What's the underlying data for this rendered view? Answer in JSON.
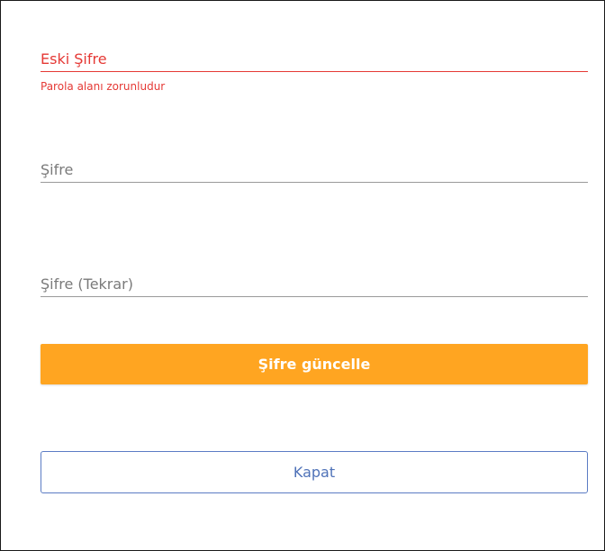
{
  "form": {
    "old_password": {
      "placeholder": "Eski Şifre",
      "value": "",
      "error": "Parola alanı zorunludur"
    },
    "new_password": {
      "placeholder": "Şifre",
      "value": ""
    },
    "repeat_password": {
      "placeholder": "Şifre (Tekrar)",
      "value": ""
    },
    "update_button_label": "Şifre güncelle",
    "close_button_label": "Kapat"
  },
  "colors": {
    "error": "#e53935",
    "primary_button": "#ffa521",
    "secondary_button_border": "#5b7cc4",
    "secondary_button_text": "#4f72b8",
    "field_underline": "#9a9a9a"
  }
}
